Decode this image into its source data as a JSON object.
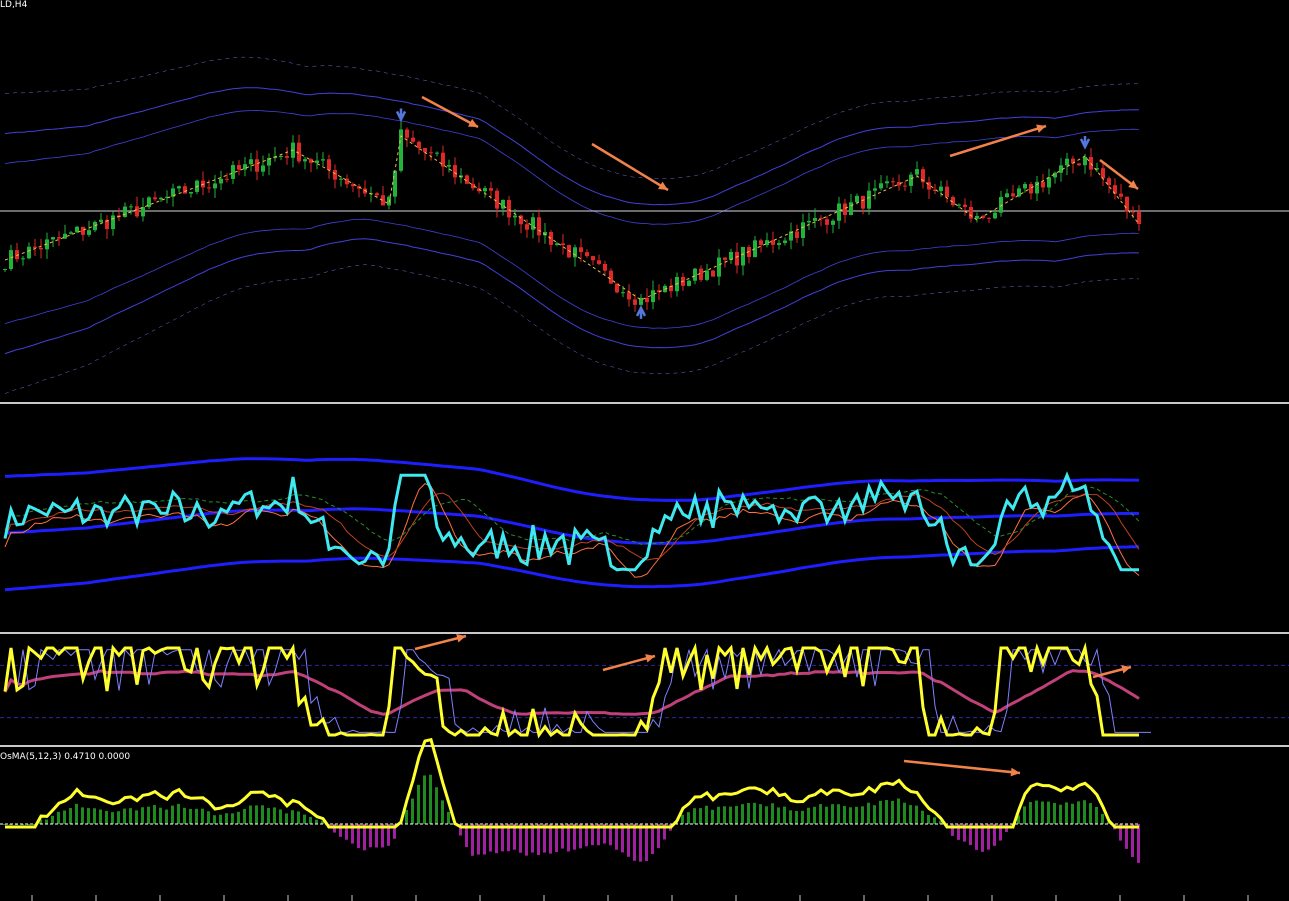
{
  "window": {
    "symbol_label": "LD,H4",
    "osma_label": "OsMA(5,12,3) 0.4710 0.0000"
  },
  "colors": {
    "background": "#000000",
    "candle_up": "#22b43a",
    "candle_down": "#e02828",
    "zigzag": "#f0c040",
    "bands_blue": "#4c4cff",
    "trend_arrow": "#f0824a",
    "fractal_arrow": "#5577dd",
    "rsi_line": "#40e8f0",
    "band_thick": "#1e1eff",
    "stoch_main": "#ffff30",
    "stoch_ma": "#c0407a",
    "osma_pos": "#1f8a1f",
    "osma_neg": "#a020a0",
    "osma_line": "#ffff30",
    "level_line": "#2a2aa0",
    "separator": "#c8c8c8"
  },
  "chart_data": [
    {
      "type": "candlestick",
      "panel": "price",
      "timeframe": "H4",
      "title": "LD,H4",
      "bars": 190,
      "swing_points": [
        {
          "bar": 0,
          "level": 0.2
        },
        {
          "bar": 48,
          "level": 0.75
        },
        {
          "bar": 64,
          "level": 0.48
        },
        {
          "bar": 66,
          "level": 0.82
        },
        {
          "bar": 106,
          "level": 0.0
        },
        {
          "bar": 152,
          "level": 0.62
        },
        {
          "bar": 162,
          "level": 0.4
        },
        {
          "bar": 180,
          "level": 0.72
        },
        {
          "bar": 189,
          "level": 0.38
        }
      ],
      "fractals": [
        {
          "bar": 66,
          "kind": "down"
        },
        {
          "bar": 106,
          "kind": "up"
        },
        {
          "bar": 180,
          "kind": "down"
        }
      ],
      "annotations": [
        "arrow-down-right",
        "arrow-down-right",
        "arrow-up-right",
        "arrow-down-right"
      ]
    },
    {
      "type": "line",
      "panel": "rsi-bands",
      "series": [
        {
          "role": "main-line",
          "color": "#40e8f0"
        },
        {
          "role": "upper-band",
          "color": "#1e1eff"
        },
        {
          "role": "lower-band",
          "color": "#1e1eff"
        },
        {
          "role": "middle-band",
          "color": "#1e1eff"
        }
      ]
    },
    {
      "type": "line",
      "panel": "stochastic",
      "levels": [
        80,
        20
      ],
      "series": [
        {
          "role": "main-line",
          "color": "#ffff30"
        },
        {
          "role": "signal",
          "color": "#c0407a"
        }
      ],
      "annotations": [
        "arrow-up-right",
        "arrow-up-right",
        "arrow-up-right"
      ]
    },
    {
      "type": "bar",
      "panel": "osma",
      "title": "OsMA(5,12,3) 0.4710 0.0000",
      "params": [
        5,
        12,
        3
      ],
      "values_shown": [
        0.471,
        0.0
      ],
      "annotations": [
        "arrow-right"
      ]
    }
  ]
}
